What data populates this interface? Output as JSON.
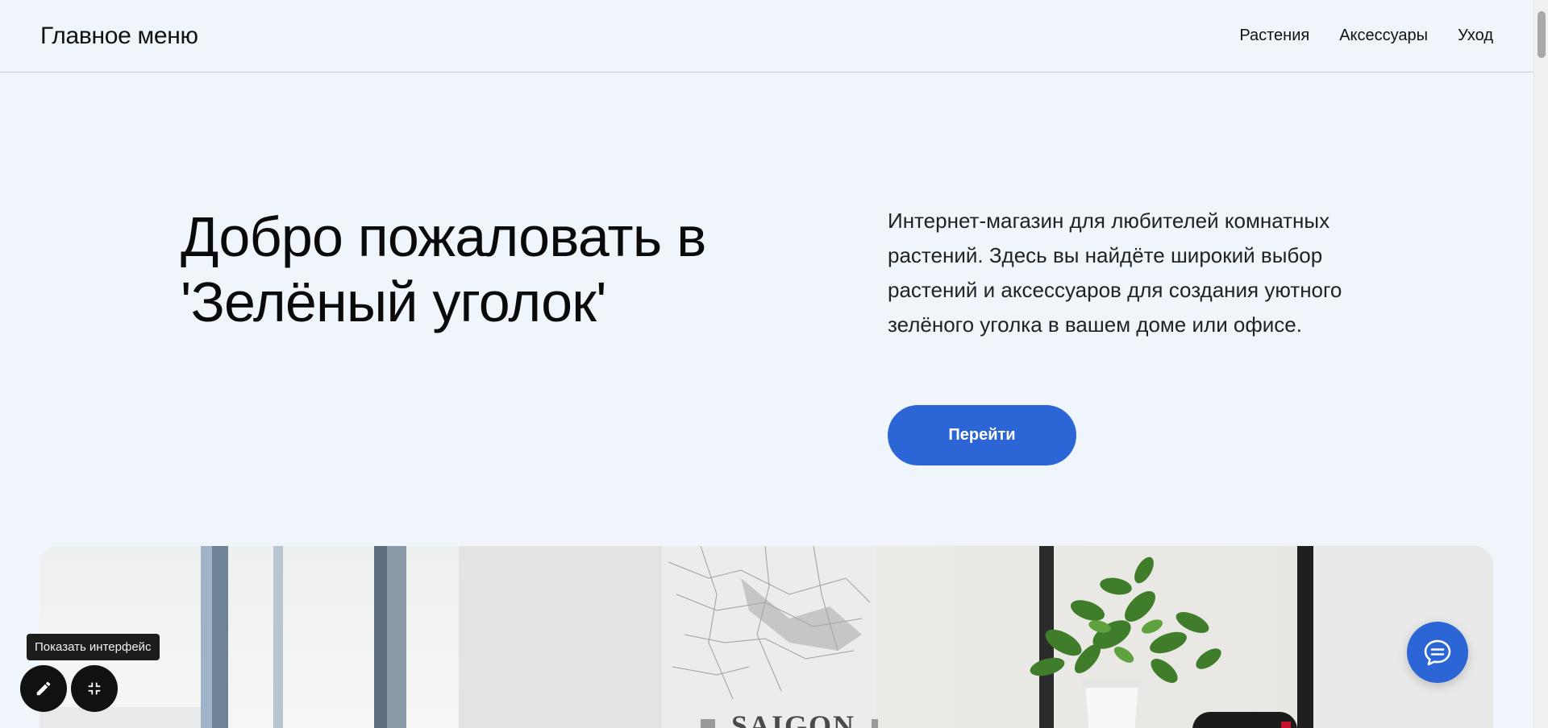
{
  "header": {
    "brand": "Главное меню",
    "nav": [
      {
        "label": "Растения"
      },
      {
        "label": "Аксессуары"
      },
      {
        "label": "Уход"
      }
    ]
  },
  "hero": {
    "title": "Добро пожаловать в 'Зелёный уголок'",
    "description": "Интернет-магазин для любителей комнатных растений. Здесь вы найдёте широкий выбор растений и аксессуаров для создания уютного зелёного уголка в вашем доме или офисе.",
    "button_label": "Перейти"
  },
  "banner": {
    "poster_text": "SAIGON"
  },
  "floating": {
    "tooltip": "Показать интерфейс",
    "edit_icon": "pencil-icon",
    "collapse_icon": "collapse-icon",
    "chat_icon": "chat-icon"
  },
  "colors": {
    "accent": "#2b65d6",
    "background": "#f0f4fb"
  }
}
